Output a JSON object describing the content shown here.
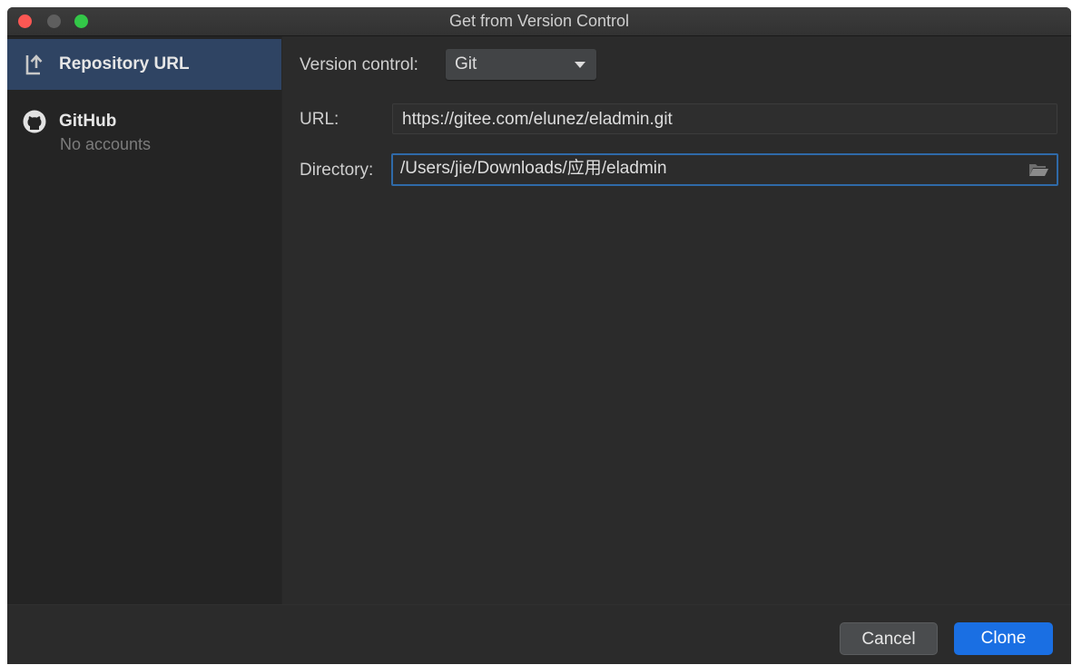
{
  "window": {
    "title": "Get from Version Control"
  },
  "sidebar": {
    "items": [
      {
        "label": "Repository URL",
        "icon": "repository-url-icon",
        "selected": true
      },
      {
        "label": "GitHub",
        "icon": "github-icon",
        "sublabel": "No accounts",
        "selected": false
      }
    ]
  },
  "form": {
    "version_control_label": "Version control:",
    "version_control_value": "Git",
    "url_label": "URL:",
    "url_value": "https://gitee.com/elunez/eladmin.git",
    "directory_label": "Directory:",
    "directory_value": "/Users/jie/Downloads/应用/eladmin"
  },
  "footer": {
    "cancel_label": "Cancel",
    "clone_label": "Clone"
  },
  "colors": {
    "accent": "#1a6fe3",
    "selection": "#2f4463",
    "focus_border": "#2f6aa8",
    "close": "#fc5753",
    "maximize": "#33c748"
  }
}
